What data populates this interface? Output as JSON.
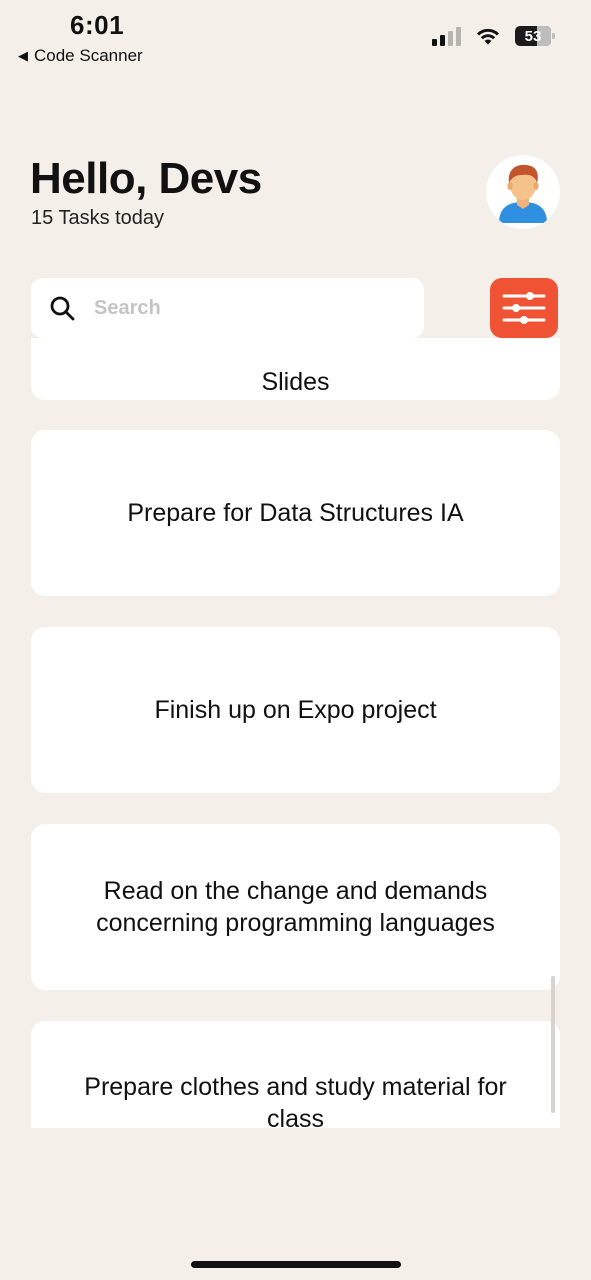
{
  "status_bar": {
    "time": "6:01",
    "back_app": "Code Scanner",
    "battery": "53"
  },
  "header": {
    "greeting": "Hello, Devs",
    "task_count": "15 Tasks today",
    "avatar_icon": "person-avatar-icon"
  },
  "search": {
    "placeholder": "Search",
    "value": ""
  },
  "filter_icon": "sliders-icon",
  "accent_color": "#ef5333",
  "background_color": "#f5efe9",
  "tasks": [
    {
      "title": "Slides"
    },
    {
      "title": "Prepare for Data Structures IA"
    },
    {
      "title": "Finish up on Expo project"
    },
    {
      "title": "Read on the change and demands concerning programming languages"
    },
    {
      "title": "Prepare clothes and study material for class"
    }
  ]
}
